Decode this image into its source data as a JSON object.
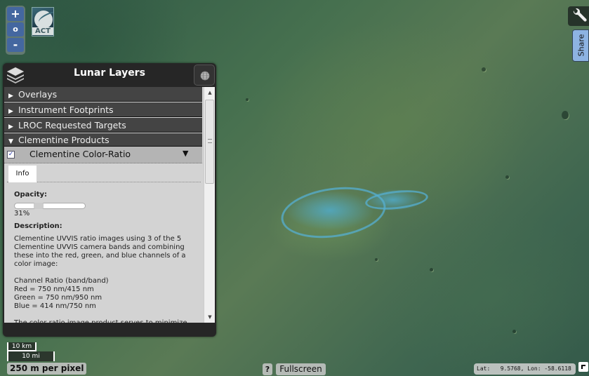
{
  "map": {
    "zoom_in_label": "+",
    "zoom_reset_label": "o",
    "zoom_out_label": "-",
    "logo_text": "ACT"
  },
  "layers_panel": {
    "title": "Lunar Layers",
    "categories": [
      {
        "label": "Overlays",
        "expanded": false,
        "arrow": "▶"
      },
      {
        "label": "Instrument Footprints",
        "expanded": false,
        "arrow": "▶"
      },
      {
        "label": "LROC Requested Targets",
        "expanded": false,
        "arrow": "▶"
      },
      {
        "label": "Clementine Products",
        "expanded": true,
        "arrow": "▼"
      }
    ],
    "layer": {
      "name": "Clementine Color-Ratio",
      "checked": true,
      "check_glyph": "✓",
      "menu_glyph": "▼"
    },
    "tabs": [
      {
        "label": "Info",
        "active": true
      }
    ],
    "info": {
      "opacity_label": "Opacity:",
      "opacity_percent": 31,
      "opacity_text": "31%",
      "description_label": "Description:",
      "description_paragraphs": [
        "Clementine UVVIS ratio images using 3 of the 5 Clementine UVVIS camera bands and combining these into the red, green, and blue channels of a color image:",
        "Channel Ratio (band/band)\nRed = 750 nm/415 nm\nGreen = 750 nm/950 nm\nBlue = 414 nm/750 nm",
        "The color ratio image product serves to minimize"
      ]
    },
    "scroll_up_glyph": "▲",
    "scroll_down_glyph": "▼"
  },
  "scale": {
    "km_label": "10 km",
    "mi_label": "10 mi",
    "resolution": "250 m per pixel"
  },
  "footer": {
    "help_label": "?",
    "fullscreen_label": "Fullscreen",
    "coords_text": "Lat:   9.5768, Lon: -58.6118"
  },
  "right_tools": {
    "share_label": "Share"
  }
}
